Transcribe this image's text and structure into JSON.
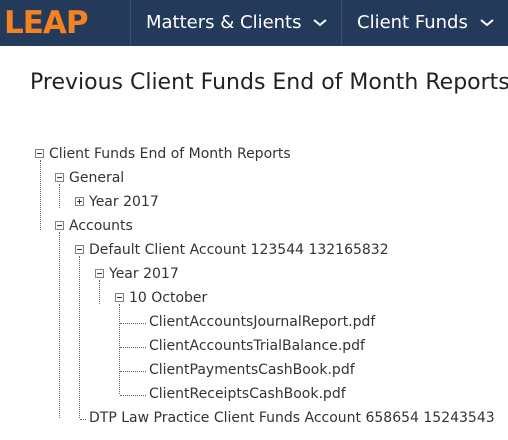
{
  "topbar": {
    "logo_text": "LEAP",
    "nav": [
      {
        "label": "Matters & Clients"
      },
      {
        "label": "Client Funds"
      }
    ]
  },
  "page": {
    "title": "Previous Client Funds End of Month Reports"
  },
  "tree": {
    "root": "Client Funds End of Month Reports",
    "general": "General",
    "general_year": "Year 2017",
    "accounts": "Accounts",
    "default_account": "Default Client Account 123544 132165832",
    "default_year": "Year 2017",
    "month": "10 October",
    "files": [
      "ClientAccountsJournalReport.pdf",
      "ClientAccountsTrialBalance.pdf",
      "ClientPaymentsCashBook.pdf",
      "ClientReceiptsCashBook.pdf"
    ],
    "dtp_account": "DTP Law Practice Client Funds Account 658654 15243543"
  }
}
